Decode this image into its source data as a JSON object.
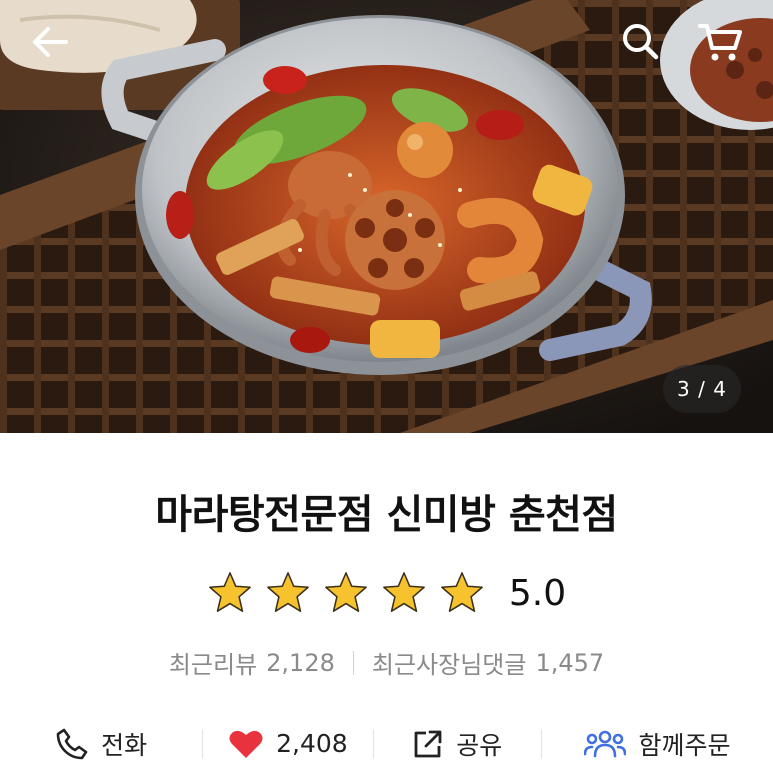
{
  "header": {
    "back_icon": "arrow-left-icon",
    "search_icon": "search-icon",
    "cart_icon": "cart-icon"
  },
  "gallery": {
    "current": 3,
    "total": 4,
    "indicator": "3 / 4"
  },
  "store": {
    "name": "마라탕전문점 신미방 춘천점",
    "rating": 5.0,
    "rating_text": "5.0",
    "stars_filled": 5,
    "stars_total": 5,
    "star_color": "#F6C22D"
  },
  "counts": {
    "reviews_label": "최근리뷰",
    "reviews_value": "2,128",
    "owner_replies_label": "최근사장님댓글",
    "owner_replies_value": "1,457"
  },
  "actions": {
    "call_label": "전화",
    "call_icon": "phone-icon",
    "likes_value": "2,408",
    "likes_icon": "heart-icon",
    "likes_color": "#E8333F",
    "share_label": "공유",
    "share_icon": "share-icon",
    "group_label": "함께주문",
    "group_icon": "group-icon",
    "group_color": "#3F6FE0"
  }
}
